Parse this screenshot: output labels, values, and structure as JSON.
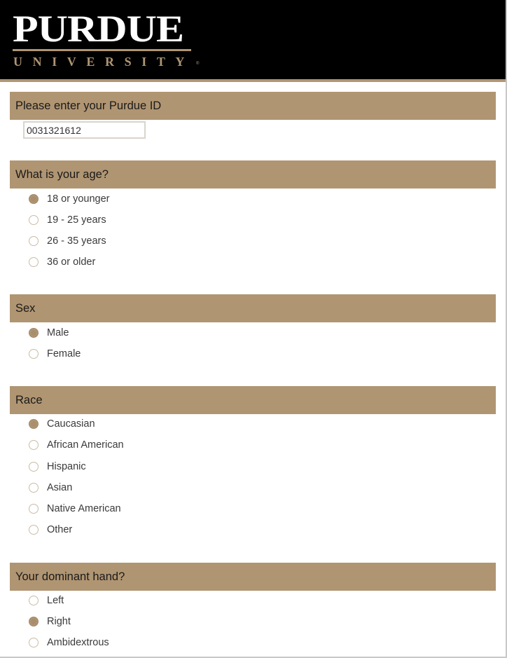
{
  "brand": {
    "logo_word": "PURDUE",
    "logo_sub": "UNIVERSITY",
    "logo_mark": "®",
    "accent_color": "#b09572"
  },
  "purdue_id": {
    "label": "Please enter your Purdue ID",
    "value": "0031321612"
  },
  "age": {
    "label": "What is your age?",
    "options": [
      "18 or younger",
      "19 - 25 years",
      "26 - 35 years",
      "36 or older"
    ],
    "selected": "18 or younger"
  },
  "sex": {
    "label": "Sex",
    "options": [
      "Male",
      "Female"
    ],
    "selected": "Male"
  },
  "race": {
    "label": "Race",
    "options": [
      "Caucasian",
      "African American",
      "Hispanic",
      "Asian",
      "Native American",
      "Other"
    ],
    "selected": "Caucasian"
  },
  "hand": {
    "label": "Your dominant hand?",
    "options": [
      "Left",
      "Right",
      "Ambidextrous"
    ],
    "selected": "Right"
  }
}
